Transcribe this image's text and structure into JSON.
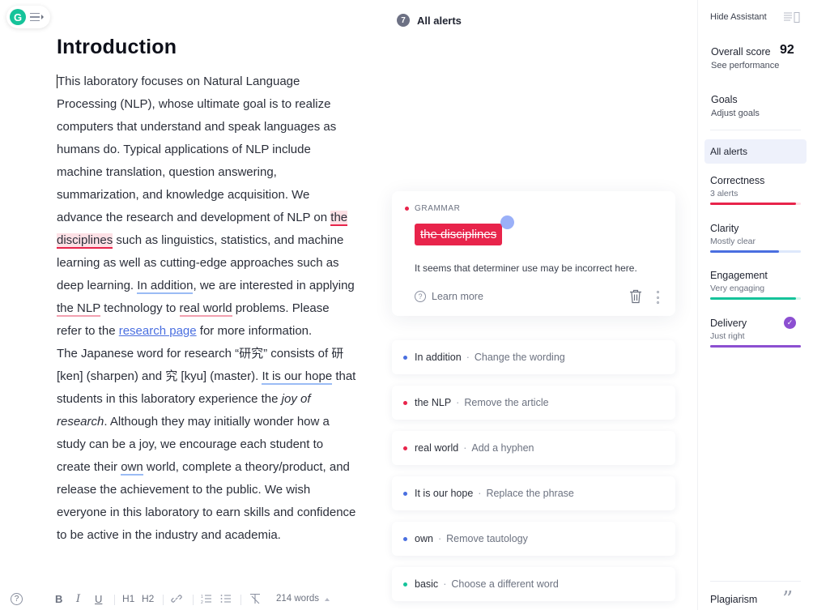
{
  "logo": {
    "letter": "G"
  },
  "document": {
    "title": "Introduction",
    "segments": {
      "s1": "This laboratory focuses on Natural Language Processing (NLP), whose ultimate goal is to realize computers that understand and speak languages as humans do. Typical applications of NLP include machine translation, question answering, summarization, and knowledge acquisition. We advance the research and development of NLP on ",
      "h1": "the disciplines",
      "s2": " such as linguistics, statistics, and machine learning as well as cutting-edge approaches such as deep learning. ",
      "h2": "In addition",
      "s3": ", we are interested in applying ",
      "h3": "the NLP",
      "s4": " technology to ",
      "h4": "real world",
      "s5": " problems. Please refer to the ",
      "link": "research page",
      "s6": " for more information.",
      "p2a": "The Japanese word for research “研究” consists of 研 [ken] (sharpen) and 究 [kyu] (master). ",
      "h5": "It is our hope",
      "p2b": " that students in this laboratory experience the ",
      "italic": "joy of research",
      "p2c": ". Although they may initially wonder how a study can be a joy, we encourage each student to create their ",
      "h6": "own",
      "p2d": " world, complete a theory/product, and release the achievement to the public. We wish everyone in this laboratory to earn skills and confidence to be active in the industry and academia."
    }
  },
  "toolbar": {
    "help": "?",
    "bold": "B",
    "italic": "I",
    "underline": "U",
    "h1": "H1",
    "h2": "H2",
    "word_count": "214 words"
  },
  "alerts": {
    "count": "7",
    "title": "All alerts",
    "active": {
      "category": "GRAMMAR",
      "chip_text": "the disciplines",
      "chip_color": "#e8244b",
      "description": "It seems that determiner use may be incorrect here.",
      "learn_more": "Learn more"
    },
    "items": [
      {
        "word": "In addition",
        "action": "Change the wording",
        "color": "#4a6fe0"
      },
      {
        "word": "the NLP",
        "action": "Remove the article",
        "color": "#e8244b"
      },
      {
        "word": "real world",
        "action": "Add a hyphen",
        "color": "#e8244b"
      },
      {
        "word": "It is our hope",
        "action": "Replace the phrase",
        "color": "#4a6fe0"
      },
      {
        "word": "own",
        "action": "Remove tautology",
        "color": "#4a6fe0"
      },
      {
        "word": "basic",
        "action": "Choose a different word",
        "color": "#15c39a"
      }
    ],
    "separator": "·"
  },
  "sidebar": {
    "hide_assistant": "Hide Assistant",
    "overall_score_label": "Overall score",
    "overall_score": "92",
    "see_performance": "See performance",
    "goals": "Goals",
    "adjust_goals": "Adjust goals",
    "all_alerts": "All alerts",
    "categories": [
      {
        "name": "Correctness",
        "status": "3 alerts",
        "color": "#e8244b",
        "track": "#fde0e5",
        "fill": 0.95
      },
      {
        "name": "Clarity",
        "status": "Mostly clear",
        "color": "#4a6fe0",
        "track": "#dde8fb",
        "fill": 0.76
      },
      {
        "name": "Engagement",
        "status": "Very engaging",
        "color": "#15c39a",
        "track": "#d6f5ec",
        "fill": 0.95
      },
      {
        "name": "Delivery",
        "status": "Just right",
        "color": "#8c4fd1",
        "track": "#eadcf8",
        "fill": 1.0,
        "check": "✓"
      }
    ],
    "plagiarism": "Plagiarism"
  }
}
